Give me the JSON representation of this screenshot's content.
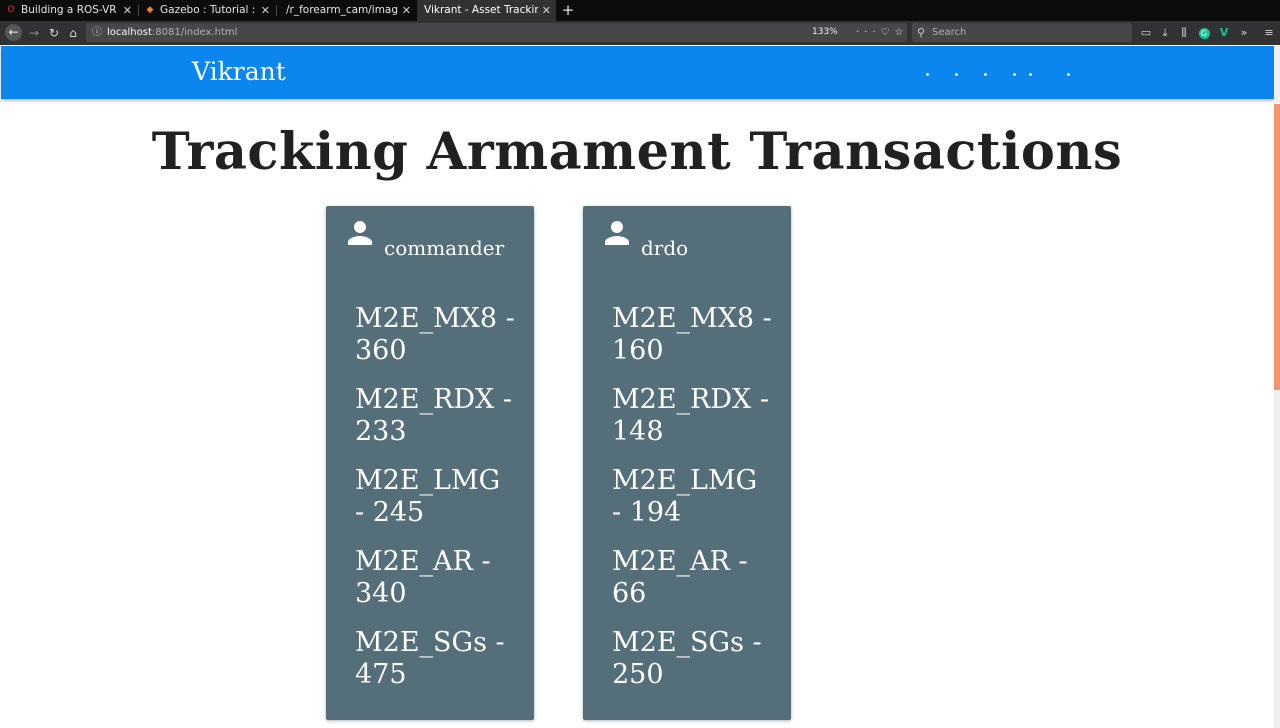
{
  "browser": {
    "tabs": [
      {
        "title": "Building a ROS-VR An",
        "favicon": "opera-icon",
        "active": false
      },
      {
        "title": "Gazebo : Tutorial : RO",
        "favicon": "gazebo-icon",
        "active": false
      },
      {
        "title": "/r_forearm_cam/image_",
        "favicon": "",
        "active": false
      },
      {
        "title": "Vikrant - Asset Tracking",
        "favicon": "",
        "active": true
      }
    ],
    "url_host": "localhost",
    "url_rest": ":8081/index.html",
    "zoom": "133%",
    "search_placeholder": "Search"
  },
  "app": {
    "brand": "Vikrant",
    "title": "Tracking Armament Transactions",
    "colors": {
      "appbar": "#0c86ef",
      "card": "#546e7a",
      "scroll_thumb": "#f19474"
    }
  },
  "users": [
    {
      "name": "commander",
      "icon": "person-icon",
      "items": [
        "M2E_MX8 - 360",
        "M2E_RDX - 233",
        "M2E_LMG - 245",
        "M2E_AR - 340",
        "M2E_SGs - 475"
      ]
    },
    {
      "name": "drdo",
      "icon": "person-icon",
      "items": [
        "M2E_MX8 - 160",
        "M2E_RDX - 148",
        "M2E_LMG - 194",
        "M2E_AR - 66",
        "M2E_SGs - 250"
      ]
    }
  ]
}
